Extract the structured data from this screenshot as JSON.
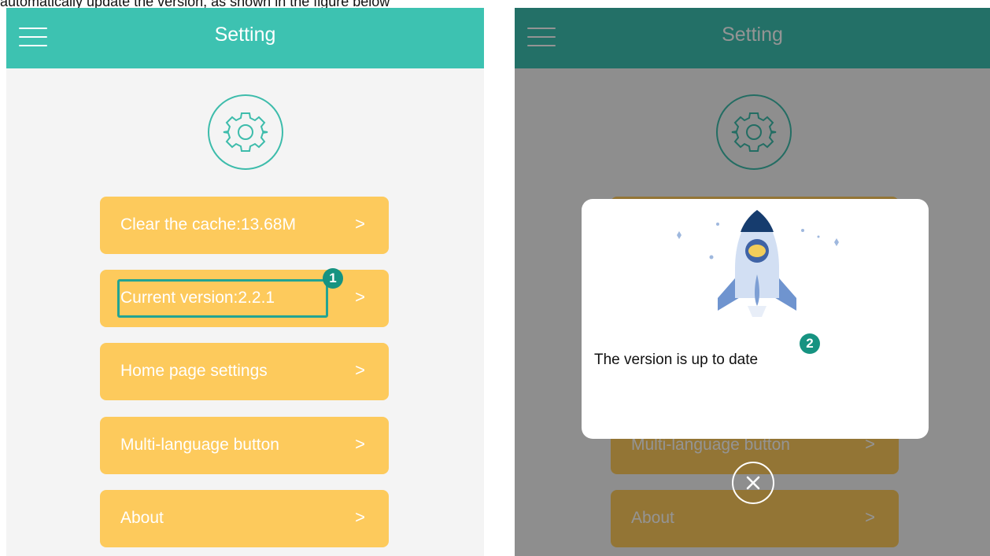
{
  "caption": "automatically update the version, as shown in the figure below",
  "colors": {
    "appbar": "#3dc2b1",
    "button": "#fdca5c",
    "highlight": "#22a493",
    "badge": "#169381"
  },
  "left_screen": {
    "appbar_title": "Setting",
    "menu_icon": "hamburger-menu-icon",
    "settings_icon": "gear-icon",
    "menu_items": [
      {
        "label": "Clear the cache:13.68M",
        "chevron": ">"
      },
      {
        "label": "Current version:2.2.1",
        "chevron": ">"
      },
      {
        "label": "Home page settings",
        "chevron": ">"
      },
      {
        "label": "Multi-language button",
        "chevron": ">"
      },
      {
        "label": "About",
        "chevron": ">"
      }
    ],
    "step_badge": "1"
  },
  "right_screen": {
    "appbar_title": "Setting",
    "menu_items": [
      {
        "label": "Multi-language button",
        "chevron": ">"
      },
      {
        "label": "About",
        "chevron": ">"
      }
    ],
    "dialog": {
      "illustration": "rocket-icon",
      "message": "The version is up to date",
      "step_badge": "2"
    },
    "close_icon": "close-icon"
  }
}
